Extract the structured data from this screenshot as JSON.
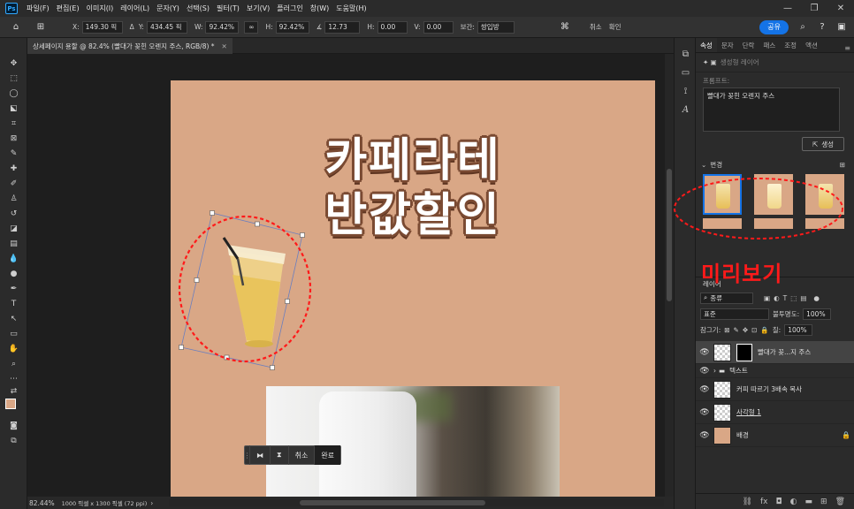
{
  "menu": {
    "logo": "Ps",
    "items": [
      "파일(F)",
      "편집(E)",
      "이미지(I)",
      "레이어(L)",
      "문자(Y)",
      "선택(S)",
      "필터(T)",
      "보기(V)",
      "플러그인",
      "창(W)",
      "도움말(H)"
    ]
  },
  "options": {
    "x_label": "X:",
    "x_value": "149.30 픽",
    "y_label": "Y:",
    "y_value": "434.45 픽",
    "w_label": "W:",
    "w_value": "92.42%",
    "h_label": "H:",
    "h_value": "92.42%",
    "angle_value": "12.73",
    "hskew_label": "H:",
    "hskew_value": "0.00",
    "vskew_label": "V:",
    "vskew_value": "0.00",
    "interp_label": "보간:",
    "interp_value": "쌍입방",
    "cancel_label": "취소",
    "commit_label": "확인",
    "share_label": "공유"
  },
  "document": {
    "tab_title": "상세페이지 용할 @ 82.4% (빨대가 꽂힌 오렌지 주스, RGB/8) *",
    "headline_line1": "카페라테",
    "headline_line2": "반값할인"
  },
  "transform_bar": {
    "cancel": "취소",
    "done": "완료"
  },
  "status": {
    "zoom": "82.44%",
    "doc_info": "1000 픽셀 x 1300 픽셀 (72 ppi)"
  },
  "properties": {
    "tabs": [
      "속성",
      "문자",
      "단락",
      "패스",
      "조정",
      "액션"
    ],
    "gen_layer_label": "생성형 레이어",
    "prompt_label": "프롬프트:",
    "prompt_text": "빨대가 꽂힌 오렌지 주스",
    "generate_label": "생성",
    "variants_label": "변경"
  },
  "annotation": {
    "preview_label": "미리보기"
  },
  "layers": {
    "tab": "레이어",
    "search_kind": "종류",
    "blend_mode": "표준",
    "opacity_label": "불투명도:",
    "opacity_value": "100%",
    "lock_label": "잠그기:",
    "fill_label": "칠:",
    "fill_value": "100%",
    "items": [
      {
        "name": "빨대가 꽂...지 주스"
      },
      {
        "name": "텍스트"
      },
      {
        "name": "커피 따르기 3배속 복사"
      },
      {
        "name": "사각형 1"
      },
      {
        "name": "배경"
      }
    ]
  },
  "colors": {
    "artboard": "#d9a786",
    "accent": "#1473e6",
    "annotation": "#ff1a1a"
  }
}
